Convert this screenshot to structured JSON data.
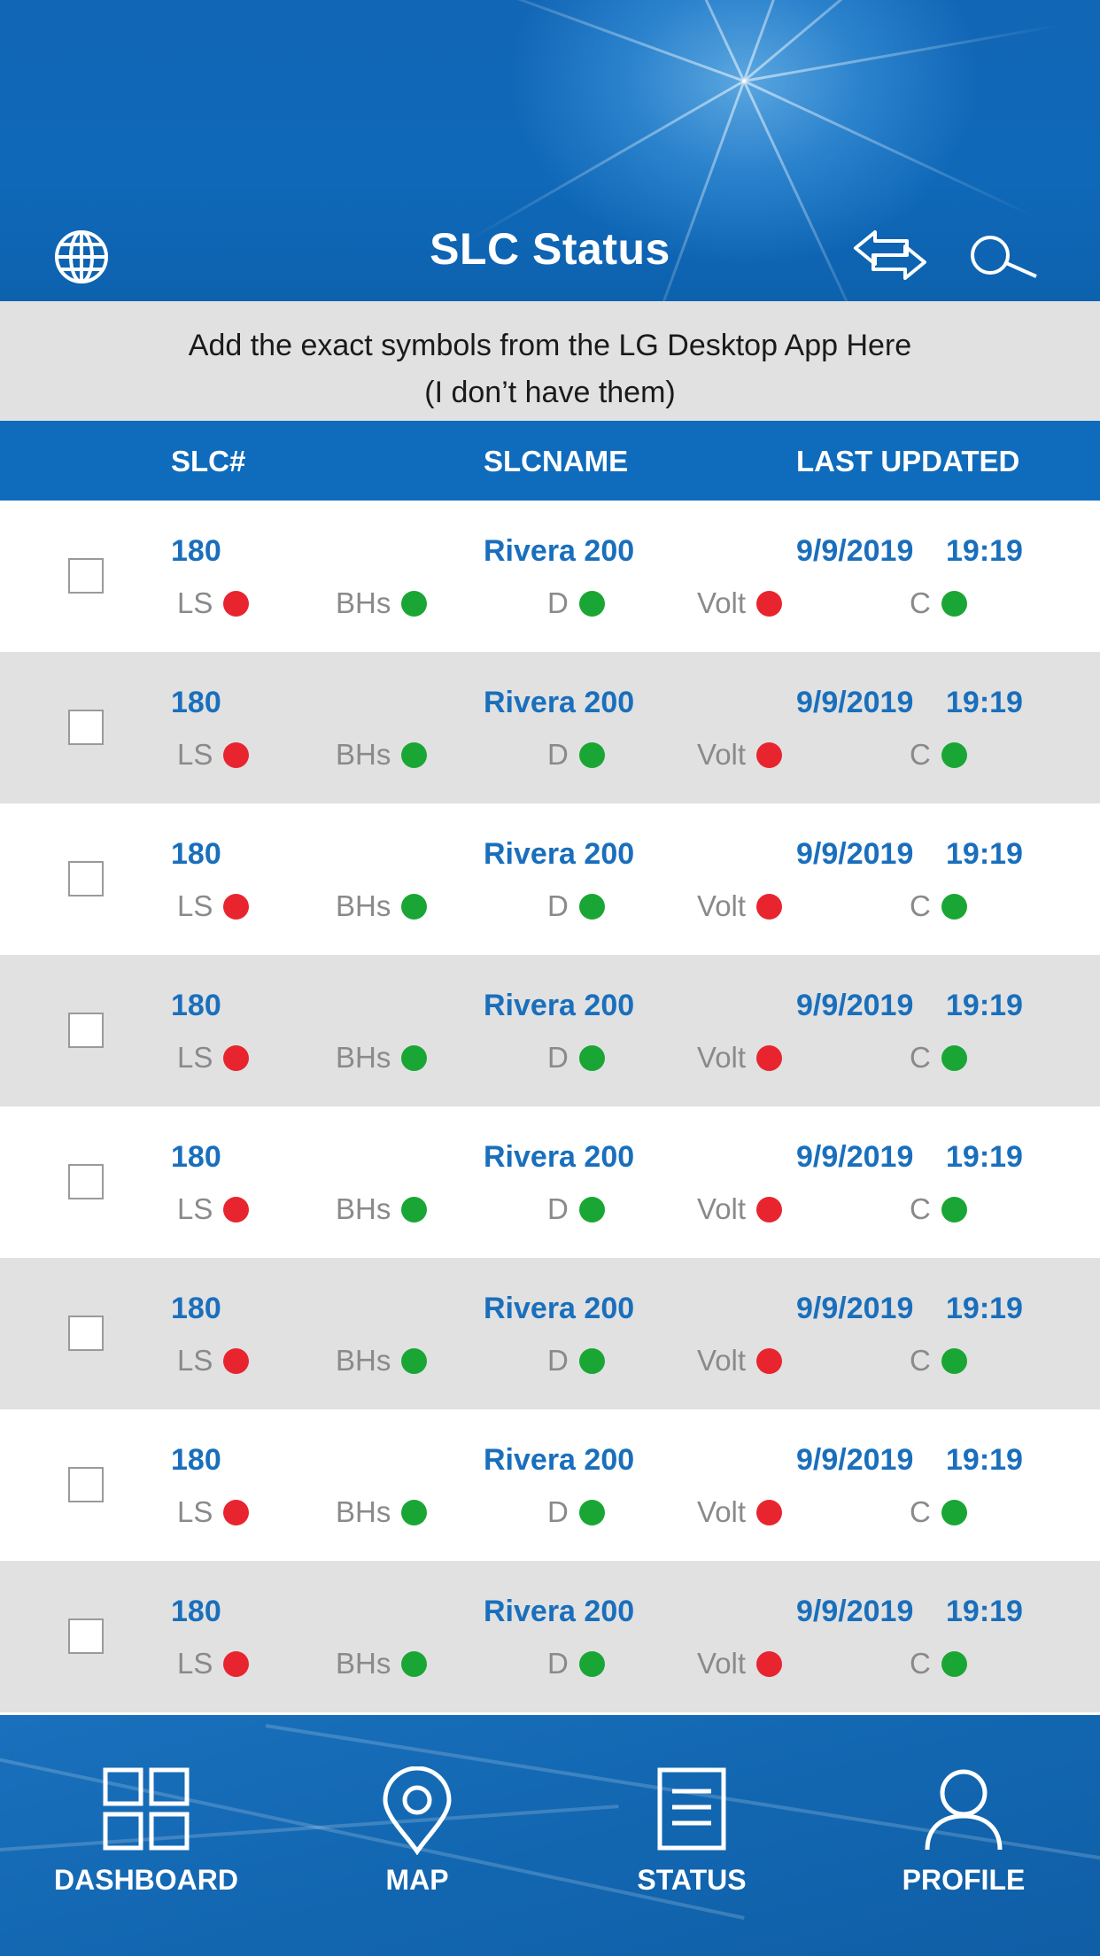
{
  "header": {
    "title": "SLC Status",
    "icons": [
      "globe-icon",
      "swap-arrows-icon",
      "search-icon"
    ]
  },
  "notice": {
    "line1": "Add the exact symbols from the LG Desktop App Here",
    "line2": "(I don’t have them)"
  },
  "columns": {
    "slc": "SLC#",
    "name": "SLCNAME",
    "updated": "LAST UPDATED"
  },
  "colors": {
    "primary": "#0f6bbb",
    "status_red": "#e8252f",
    "status_green": "#1aa634",
    "row_alt": "#e1e1e1"
  },
  "rows": [
    {
      "slc": "180",
      "name": "Rivera 200",
      "date": "9/9/2019",
      "time": "19:19",
      "ls": "LS",
      "ls_status": "red",
      "bhs": "BHs",
      "bhs_status": "green",
      "d": "D",
      "d_status": "green",
      "volt": "Volt",
      "volt_status": "red",
      "c": "C",
      "c_status": "green"
    },
    {
      "slc": "180",
      "name": "Rivera 200",
      "date": "9/9/2019",
      "time": "19:19",
      "ls": "LS",
      "ls_status": "red",
      "bhs": "BHs",
      "bhs_status": "green",
      "d": "D",
      "d_status": "green",
      "volt": "Volt",
      "volt_status": "red",
      "c": "C",
      "c_status": "green"
    },
    {
      "slc": "180",
      "name": "Rivera 200",
      "date": "9/9/2019",
      "time": "19:19",
      "ls": "LS",
      "ls_status": "red",
      "bhs": "BHs",
      "bhs_status": "green",
      "d": "D",
      "d_status": "green",
      "volt": "Volt",
      "volt_status": "red",
      "c": "C",
      "c_status": "green"
    },
    {
      "slc": "180",
      "name": "Rivera 200",
      "date": "9/9/2019",
      "time": "19:19",
      "ls": "LS",
      "ls_status": "red",
      "bhs": "BHs",
      "bhs_status": "green",
      "d": "D",
      "d_status": "green",
      "volt": "Volt",
      "volt_status": "red",
      "c": "C",
      "c_status": "green"
    },
    {
      "slc": "180",
      "name": "Rivera 200",
      "date": "9/9/2019",
      "time": "19:19",
      "ls": "LS",
      "ls_status": "red",
      "bhs": "BHs",
      "bhs_status": "green",
      "d": "D",
      "d_status": "green",
      "volt": "Volt",
      "volt_status": "red",
      "c": "C",
      "c_status": "green"
    },
    {
      "slc": "180",
      "name": "Rivera 200",
      "date": "9/9/2019",
      "time": "19:19",
      "ls": "LS",
      "ls_status": "red",
      "bhs": "BHs",
      "bhs_status": "green",
      "d": "D",
      "d_status": "green",
      "volt": "Volt",
      "volt_status": "red",
      "c": "C",
      "c_status": "green"
    },
    {
      "slc": "180",
      "name": "Rivera 200",
      "date": "9/9/2019",
      "time": "19:19",
      "ls": "LS",
      "ls_status": "red",
      "bhs": "BHs",
      "bhs_status": "green",
      "d": "D",
      "d_status": "green",
      "volt": "Volt",
      "volt_status": "red",
      "c": "C",
      "c_status": "green"
    },
    {
      "slc": "180",
      "name": "Rivera 200",
      "date": "9/9/2019",
      "time": "19:19",
      "ls": "LS",
      "ls_status": "red",
      "bhs": "BHs",
      "bhs_status": "green",
      "d": "D",
      "d_status": "green",
      "volt": "Volt",
      "volt_status": "red",
      "c": "C",
      "c_status": "green"
    }
  ],
  "nav": [
    {
      "label": "DASHBOARD",
      "icon": "dashboard-grid-icon"
    },
    {
      "label": "MAP",
      "icon": "map-pin-icon"
    },
    {
      "label": "STATUS",
      "icon": "status-document-icon"
    },
    {
      "label": "PROFILE",
      "icon": "profile-user-icon"
    }
  ]
}
